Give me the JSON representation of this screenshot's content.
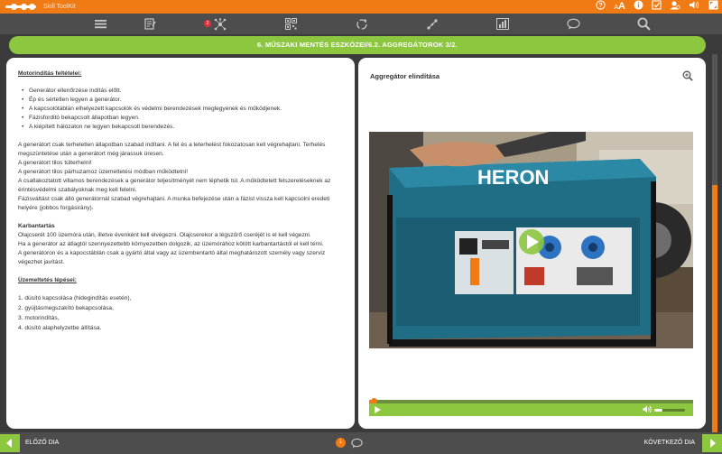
{
  "app": {
    "title": "Skill ToolKit",
    "font_size_small": "A",
    "font_size_large": "A",
    "toolbar_badge": "2"
  },
  "colors": {
    "brand_orange": "#f07a14",
    "accent_green": "#8dc63f",
    "toolbar_gray": "#4d4d4d"
  },
  "lesson": {
    "header": "6. MŰSZAKI MENTÉS ESZKÖZEI/6.2. AGGREGÁTOROK 3/2."
  },
  "left": {
    "heading1": "Motorindítás feltételei:",
    "bullets": [
      "Generátor ellenőrzése indítás előtt.",
      "Ép és sértetlen legyen a generátor.",
      "A kapcsolótáblán elhelyezett kapcsolók és védelmi berendezések meglegyenek és működjenek.",
      "Fázisforditó bekapcsolt állapotban legyen.",
      "A kiépített hálózaton ne legyen bekapcsolt berendezés."
    ],
    "para1": [
      "A generátort csak terheletlen állapotban szabad indítani. A fel és a leterhelést fokozatosan kell végrehajtani. Terhelés megszüntetése után a generátort még járassuk üresen.",
      "A generátort tilos túlterhelni!",
      "A generátort tilos párhuzamoz üzemeltetési módban működtetni!",
      "A csatlakoztatott villamos berendezések a generátor teljesítményét nem léphetik túl. A működtetett felszereléseknek az érintésvédelmi szabályoknak meg kell felelni.",
      "Fázisváltást csak álló generátornál szabad végrehajtani. A munka befejezése után a fázist vissza kell kapcsolni eredeti helyére (jobbos forgásirány)."
    ],
    "heading2": "Karbantartás",
    "para2": [
      "Olajcserét 100 üzemóra után, illetve évenként kell elvégezni. Olajcserekor a légszűrő cseréjét is el kell végezni.",
      "Ha a generátor az átlagtól szennyezettebb környezetben dolgozik, az üzemórához kötött karbantartástól el kell térni.",
      "A generátoron és a kapocstáblán csak a gyártó által vagy az üzembentartó által meghatározott személy vagy szerviz végezhet javítást."
    ],
    "heading3": "Üzemeltetés lépései:",
    "steps": [
      "1. dúsító kapcsolása (hidegindítás esetén),",
      "2. gyújtásmegszakító bekapcsolása,",
      "3. motorindítás,",
      "4. dúsító alaphelyzetbe állítása."
    ]
  },
  "right": {
    "title": "Aggregátor elindítása",
    "video_brand_text": "HERON",
    "video_progress": 0.01,
    "volume_level": 0.27
  },
  "bottom": {
    "prev_label": "ELŐZŐ DIA",
    "next_label": "KÖVETKEZŐ DIA",
    "page_badge": "1"
  }
}
